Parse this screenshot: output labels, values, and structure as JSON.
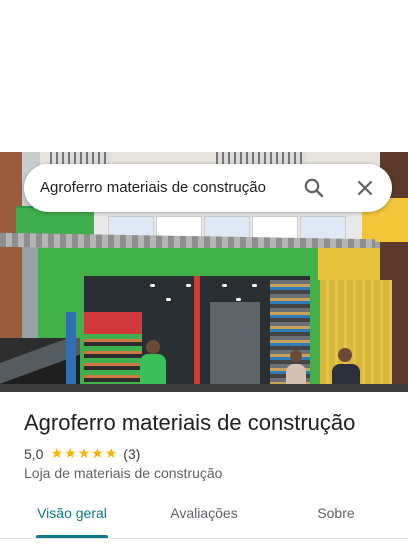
{
  "search": {
    "query": "Agroferro materiais de construção",
    "search_icon": "search-icon",
    "close_icon": "close-icon"
  },
  "place": {
    "name": "Agroferro materiais de construção",
    "rating": "5,0",
    "star_count": 5,
    "review_count": "(3)",
    "category": "Loja de materiais de construção"
  },
  "tabs": [
    {
      "label": "Visão geral",
      "active": true
    },
    {
      "label": "Avaliações",
      "active": false
    },
    {
      "label": "Sobre",
      "active": false
    }
  ],
  "colors": {
    "accent": "#0b7a86",
    "star": "#f4b400"
  }
}
